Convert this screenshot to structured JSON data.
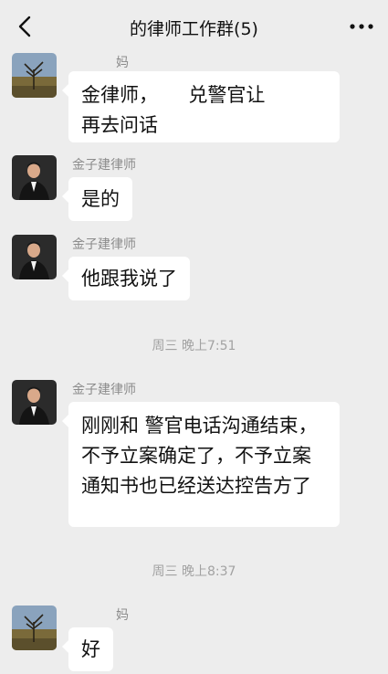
{
  "header": {
    "title": "的律师工作群(5)"
  },
  "messages": [
    {
      "sender": "妈",
      "text": "金律师，     兑警官让 \n再去问话",
      "avatar": "landscape-tree-avatar"
    },
    {
      "sender": "金子建律师",
      "text": "是的",
      "avatar": "lawyer-portrait-avatar"
    },
    {
      "sender": "金子建律师",
      "text": "他跟我说了",
      "avatar": "lawyer-portrait-avatar"
    },
    {
      "sender": "金子建律师",
      "text": "刚刚和  警官电话沟通结束，不予立案确定了，不予立案通知书也已经送达控告方了",
      "avatar": "lawyer-portrait-avatar"
    },
    {
      "sender": "妈",
      "text": "好",
      "avatar": "landscape-tree-avatar"
    }
  ],
  "timestamps": [
    "周三 晚上7:51",
    "周三 晚上8:37"
  ],
  "colors": {
    "background": "#ededed",
    "bubble": "#ffffff",
    "meta_text": "#8b8b8b"
  },
  "icons": [
    "back-chevron-icon",
    "more-dots-icon"
  ]
}
